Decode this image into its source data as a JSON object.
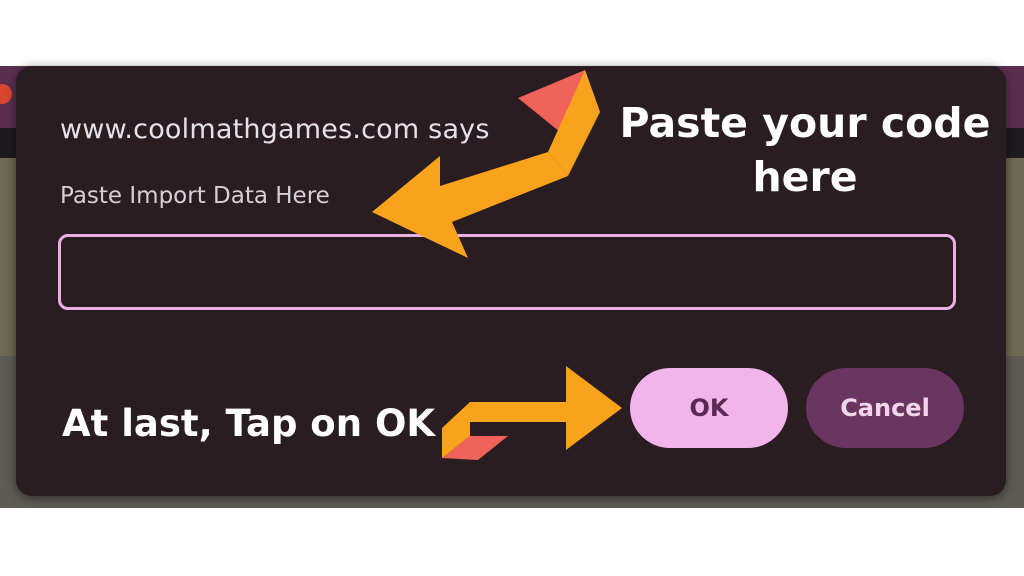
{
  "dialog": {
    "title": "www.coolmathgames.com says",
    "message": "Paste Import Data Here",
    "input_value": "",
    "ok_label": "OK",
    "cancel_label": "Cancel"
  },
  "annotations": {
    "paste_hint": "Paste your code here",
    "ok_hint": "At last, Tap on OK"
  },
  "colors": {
    "dialog_bg": "#2a1d21",
    "input_border": "#e8b1e4",
    "ok_button": "#f3b4ec",
    "cancel_button": "#6a3560",
    "arrow_orange": "#f9a21b",
    "arrow_red": "#f0625a"
  },
  "icons": {
    "paste_arrow": "curved-arrow-left-icon",
    "ok_arrow": "curved-arrow-right-icon"
  }
}
